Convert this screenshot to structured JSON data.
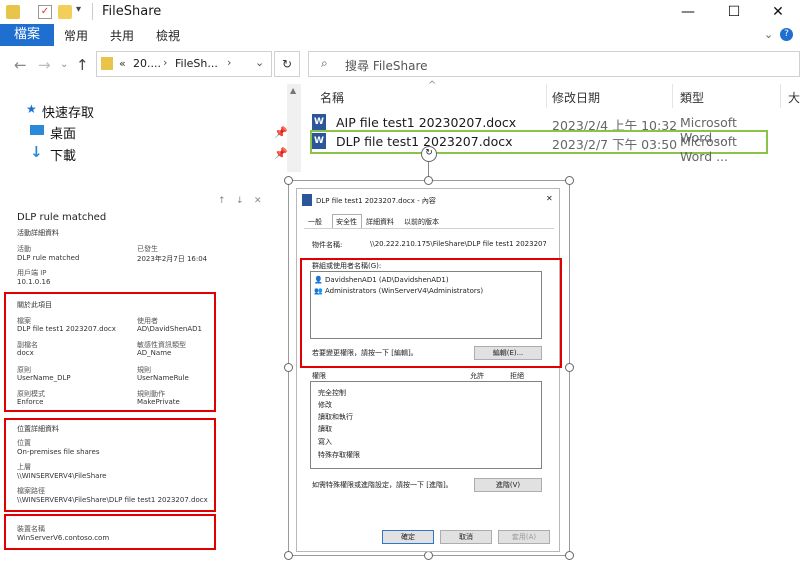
{
  "window": {
    "title": "FileShare",
    "controls": {
      "minimize": "—",
      "maximize": "☐",
      "close": "✕"
    }
  },
  "ribbon": {
    "file_tab": "檔案",
    "tabs": [
      "常用",
      "共用",
      "檢視"
    ]
  },
  "address": {
    "crumb_prefix": "«",
    "crumb1": "20....",
    "crumb2": "FileSh...",
    "search_placeholder": "搜尋 FileShare"
  },
  "nav": {
    "items": [
      {
        "label": "快速存取"
      },
      {
        "label": "桌面"
      },
      {
        "label": "下載"
      }
    ]
  },
  "files": {
    "columns": [
      "名稱",
      "修改日期",
      "類型",
      "大"
    ],
    "rows": [
      {
        "name": "AIP file test1 20230207.docx",
        "date": "2023/2/4 上午 10:32",
        "type": "Microsoft Word ..."
      },
      {
        "name": "DLP file test1 2023207.docx",
        "date": "2023/2/7 下午 03:50",
        "type": "Microsoft Word ..."
      }
    ]
  },
  "alert": {
    "title": "DLP rule matched",
    "section_activity": "活動詳細資料",
    "activity_label": "活動",
    "activity_value": "DLP rule matched",
    "occurred_label": "已發生",
    "occurred_value": "2023年2月7日 16:04",
    "client_ip_label": "用戶端 IP",
    "client_ip_value": "10.1.0.16",
    "section_item": "關於此項目",
    "file_label": "檔案",
    "file_value": "DLP file test1 2023207.docx",
    "user_label": "使用者",
    "user_value": "AD\\DavidShenAD1",
    "ext_label": "副檔名",
    "ext_value": "docx",
    "sit_label": "敏感性資訊類型",
    "sit_value": "AD_Name",
    "policy_label": "原則",
    "policy_value": "UserName_DLP",
    "rule_label": "規則",
    "rule_value": "UserNameRule",
    "mode_label": "原則模式",
    "mode_value": "Enforce",
    "action_label": "規則動作",
    "action_value": "MakePrivate",
    "section_location": "位置詳細資料",
    "location_label": "位置",
    "location_value": "On-premises file shares",
    "upper_label": "上層",
    "upper_value": "\\\\WINSERVERV4\\FileShare",
    "path_label": "檔案路徑",
    "path_value": "\\\\WINSERVERV4\\FileShare\\DLP file test1 2023207.docx",
    "device_label": "裝置名稱",
    "device_value": "WinServerV6.contoso.com"
  },
  "dialog": {
    "title": "DLP file test1 2023207.docx - 內容",
    "tabs": [
      "一般",
      "安全性",
      "詳細資料",
      "以前的版本"
    ],
    "object_label": "物件名稱:",
    "object_value": "\\\\20.222.210.175\\FileShare\\DLP file test1 2023207",
    "groups_label": "群組或使用者名稱(G):",
    "principals": [
      "DavidshenAD1 (AD\\DavidshenAD1)",
      "Administrators (WinServerV4\\Administrators)"
    ],
    "change_hint": "若要變更權限，請按一下 [編輯]。",
    "edit_button": "編輯(E)...",
    "perm_header": "權限",
    "allow_header": "允許",
    "deny_header": "拒絕",
    "permissions": [
      "完全控制",
      "修改",
      "讀取和執行",
      "讀取",
      "寫入",
      "特殊存取權限"
    ],
    "advanced_hint": "如需特殊權限或進階設定，請按一下 [進階]。",
    "advanced_button": "進階(V)",
    "ok": "確定",
    "cancel": "取消",
    "apply": "套用(A)"
  },
  "colors": {
    "accent": "#1e6fd0",
    "highlight_green": "#8bc34a",
    "annotation_red": "#e00000"
  }
}
